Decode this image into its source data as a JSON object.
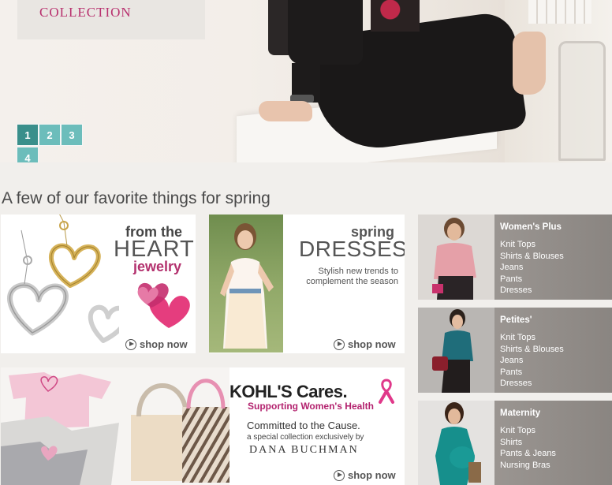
{
  "hero": {
    "collection_label": "COLLECTION",
    "pages": [
      "1",
      "2",
      "3",
      "4"
    ],
    "active_page": "1"
  },
  "section_title": "A few of our favorite things for spring",
  "promos": {
    "heart_jewelry": {
      "line1": "from the",
      "line2": "HEART",
      "line3": "jewelry",
      "cta": "shop now"
    },
    "spring_dresses": {
      "line1": "spring",
      "line2": "DRESSES",
      "line3": "Stylish new trends to complement the season",
      "cta": "shop now"
    },
    "kohls_cares": {
      "logo": "KOHL'S Cares.",
      "subtitle": "Supporting Women's Health",
      "committed": "Committed to the Cause.",
      "special": "a special collection exclusively by",
      "brand": "DANA BUCHMAN",
      "cta": "shop now"
    }
  },
  "categories": [
    {
      "title": "Women's Plus",
      "links": [
        "Knit Tops",
        "Shirts & Blouses",
        "Jeans",
        "Pants",
        "Dresses"
      ]
    },
    {
      "title": "Petites'",
      "links": [
        "Knit Tops",
        "Shirts & Blouses",
        "Jeans",
        "Pants",
        "Dresses"
      ]
    },
    {
      "title": "Maternity",
      "links": [
        "Knit Tops",
        "Shirts",
        "Pants & Jeans",
        "Nursing Bras"
      ]
    }
  ],
  "colors": {
    "brand_pink": "#b8306e",
    "pager_teal": "#6cbdbb",
    "pager_active": "#3a8f8b",
    "panel_gray": "#9a9591"
  }
}
